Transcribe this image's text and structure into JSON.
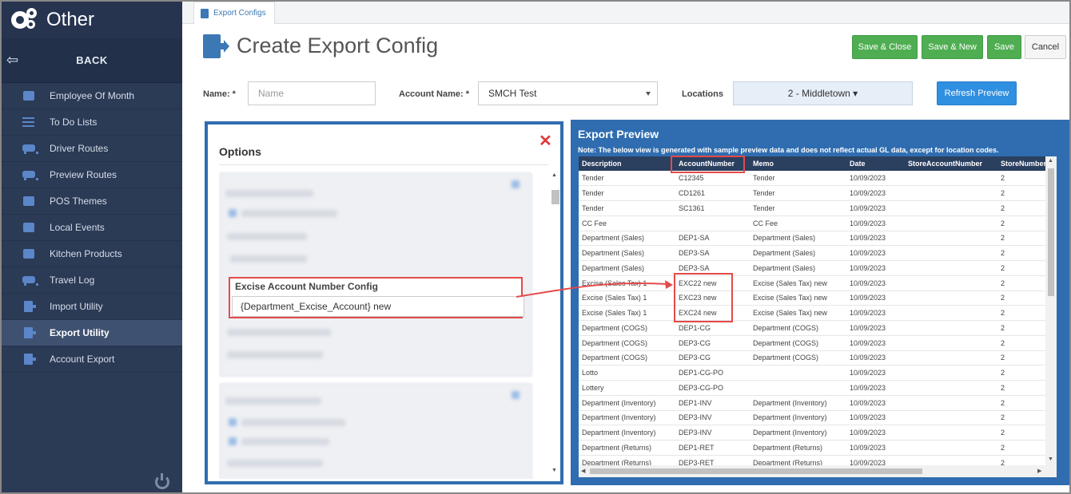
{
  "sidebar": {
    "title": "Other",
    "back_label": "BACK",
    "items": [
      {
        "label": "Employee Of Month",
        "icon": "gift-icon"
      },
      {
        "label": "To Do Lists",
        "icon": "list-icon"
      },
      {
        "label": "Driver Routes",
        "icon": "bus-icon"
      },
      {
        "label": "Preview Routes",
        "icon": "bus-icon"
      },
      {
        "label": "POS Themes",
        "icon": "image-icon"
      },
      {
        "label": "Local Events",
        "icon": "calendar-icon"
      },
      {
        "label": "Kitchen Products",
        "icon": "wrench-icon"
      },
      {
        "label": "Travel Log",
        "icon": "bus-front-icon"
      },
      {
        "label": "Import Utility",
        "icon": "import-file-icon"
      },
      {
        "label": "Export Utility",
        "icon": "export-file-icon",
        "active": true
      },
      {
        "label": "Account Export",
        "icon": "export-file-icon"
      }
    ]
  },
  "tab": {
    "label": "Export Configs"
  },
  "page": {
    "title": "Create Export Config"
  },
  "toolbar": {
    "save_close": "Save & Close",
    "save_new": "Save & New",
    "save": "Save",
    "cancel": "Cancel",
    "refresh_preview": "Refresh Preview"
  },
  "form": {
    "name_label": "Name: *",
    "name_placeholder": "Name",
    "account_name_label": "Account Name: *",
    "account_name_value": "SMCH Test",
    "locations_label": "Locations",
    "locations_value": "2 - Middletown ▾"
  },
  "options": {
    "title": "Options",
    "excise_label": "Excise Account Number Config",
    "excise_value": "{Department_Excise_Account} new"
  },
  "preview": {
    "title": "Export Preview",
    "note": "Note: The below view is generated with sample preview data and does not reflect actual GL data, except for location codes.",
    "columns": [
      "Description",
      "AccountNumber",
      "Memo",
      "Date",
      "StoreAccountNumber",
      "StoreNumber"
    ],
    "rows": [
      [
        "Tender",
        "C12345",
        "Tender",
        "10/09/2023",
        "",
        "2"
      ],
      [
        "Tender",
        "CD1261",
        "Tender",
        "10/09/2023",
        "",
        "2"
      ],
      [
        "Tender",
        "SC1361",
        "Tender",
        "10/09/2023",
        "",
        "2"
      ],
      [
        "CC Fee",
        "",
        "CC Fee",
        "10/09/2023",
        "",
        "2"
      ],
      [
        "Department (Sales)",
        "DEP1-SA",
        "Department (Sales)",
        "10/09/2023",
        "",
        "2"
      ],
      [
        "Department (Sales)",
        "DEP3-SA",
        "Department (Sales)",
        "10/09/2023",
        "",
        "2"
      ],
      [
        "Department (Sales)",
        "DEP3-SA",
        "Department (Sales)",
        "10/09/2023",
        "",
        "2"
      ],
      [
        "Excise (Sales Tax) 1",
        "EXC22 new",
        "Excise (Sales Tax) new",
        "10/09/2023",
        "",
        "2"
      ],
      [
        "Excise (Sales Tax) 1",
        "EXC23 new",
        "Excise (Sales Tax) new",
        "10/09/2023",
        "",
        "2"
      ],
      [
        "Excise (Sales Tax) 1",
        "EXC24 new",
        "Excise (Sales Tax) new",
        "10/09/2023",
        "",
        "2"
      ],
      [
        "Department (COGS)",
        "DEP1-CG",
        "Department (COGS)",
        "10/09/2023",
        "",
        "2"
      ],
      [
        "Department (COGS)",
        "DEP3-CG",
        "Department (COGS)",
        "10/09/2023",
        "",
        "2"
      ],
      [
        "Department (COGS)",
        "DEP3-CG",
        "Department (COGS)",
        "10/09/2023",
        "",
        "2"
      ],
      [
        "Lotto",
        "DEP1-CG-PO",
        "",
        "10/09/2023",
        "",
        "2"
      ],
      [
        "Lottery",
        "DEP3-CG-PO",
        "",
        "10/09/2023",
        "",
        "2"
      ],
      [
        "Department (Inventory)",
        "DEP1-INV",
        "Department (Inventory)",
        "10/09/2023",
        "",
        "2"
      ],
      [
        "Department (Inventory)",
        "DEP3-INV",
        "Department (Inventory)",
        "10/09/2023",
        "",
        "2"
      ],
      [
        "Department (Inventory)",
        "DEP3-INV",
        "Department (Inventory)",
        "10/09/2023",
        "",
        "2"
      ],
      [
        "Department (Returns)",
        "DEP1-RET",
        "Department (Returns)",
        "10/09/2023",
        "",
        "2"
      ],
      [
        "Department (Returns)",
        "DEP3-RET",
        "Department (Returns)",
        "10/09/2023",
        "",
        "2"
      ]
    ]
  },
  "colors": {
    "sidebar_bg": "#2b3a55",
    "accent_blue": "#2f6db0",
    "green": "#4fae52",
    "highlight_red": "#e44a4a"
  }
}
